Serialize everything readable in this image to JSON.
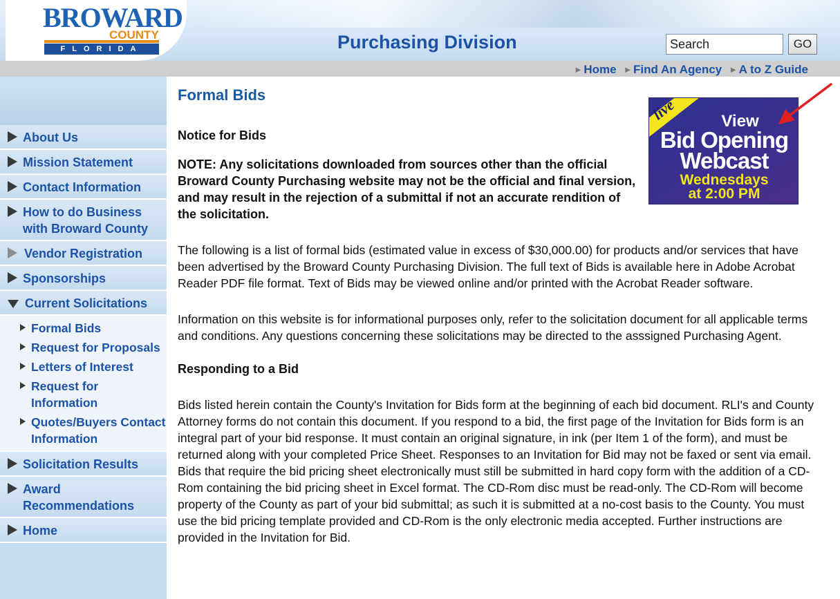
{
  "header": {
    "logo_word": "BROWARD",
    "logo_county": "COUNTY",
    "logo_state": "FLORIDA",
    "site_title": "Purchasing Division",
    "search_value": "Search",
    "go_label": "GO"
  },
  "topnav": {
    "links": [
      "Home",
      "Find An Agency",
      "A to Z Guide"
    ]
  },
  "sidebar": {
    "items": [
      {
        "label": "About Us"
      },
      {
        "label": "Mission Statement"
      },
      {
        "label": "Contact Information"
      },
      {
        "label": "How to do Business with Broward County"
      },
      {
        "label": "Vendor Registration"
      },
      {
        "label": "Sponsorships"
      },
      {
        "label": "Current Solicitations"
      },
      {
        "label": "Solicitation Results"
      },
      {
        "label": "Award Recommendations"
      },
      {
        "label": "Home"
      }
    ],
    "subitems": [
      {
        "label": "Formal Bids"
      },
      {
        "label": "Request for Proposals"
      },
      {
        "label": "Letters of Interest"
      },
      {
        "label": "Request for Information"
      },
      {
        "label": "Quotes/Buyers Contact Information"
      }
    ]
  },
  "main": {
    "title": "Formal Bids",
    "notice_heading": "Notice for Bids",
    "note": "NOTE: Any solicitations downloaded from sources other than the official Broward County Purchasing website may not be the official and final version, and may result in the rejection of a submittal if not an accurate rendition of the solicitation.",
    "para1": "The following is a list of formal bids (estimated value in excess of $30,000.00) for products and/or services that have been advertised by the Broward County Purchasing Division. The full text of Bids is available here in Adobe Acrobat Reader PDF file format. Text of Bids may be viewed online and/or printed with the Acrobat Reader software.",
    "para2": "Information on this website is for informational purposes only, refer to the solicitation document for all applicable terms and conditions.   Any questions concerning these solicitations may be directed to the asssigned Purchasing Agent.",
    "responding_heading": "Responding to a Bid",
    "para3": "Bids listed herein contain the County's Invitation for Bids form at the beginning of each bid document. RLI's and County Attorney forms do not contain this document. If you respond to a bid, the first page of the Invitation for Bids form is an integral part of your bid response. It must contain an original signature, in ink (per Item 1 of the form), and must be returned along with your completed Price Sheet. Responses to an Invitation for Bid may not be faxed or sent via email.  Bids that require the bid pricing sheet electronically must still be submitted in hard copy form with the addition of a CD-Rom containing the bid pricing sheet in Excel format.  The CD-Rom disc must be read-only.  The CD-Rom will become property of the County as part of your bid submittal; as such it is submitted at a no-cost basis to the County.  You must use the bid pricing template provided and CD-Rom is the only electronic media accepted.  Further instructions are provided in the Invitation for Bid."
  },
  "banner": {
    "live": "live",
    "line1": "View",
    "line2": "Bid Opening",
    "line3": "Webcast",
    "line4": "Wednesdays",
    "line5": "at 2:00 PM"
  },
  "colors": {
    "link_blue": "#1c53a6",
    "title_blue": "#1a5aa0",
    "sidebar_bg": "#c8dcef",
    "banner_purple": "#3b2f8f",
    "banner_yellow": "#f2e51c",
    "annotation_red": "#e02020"
  }
}
